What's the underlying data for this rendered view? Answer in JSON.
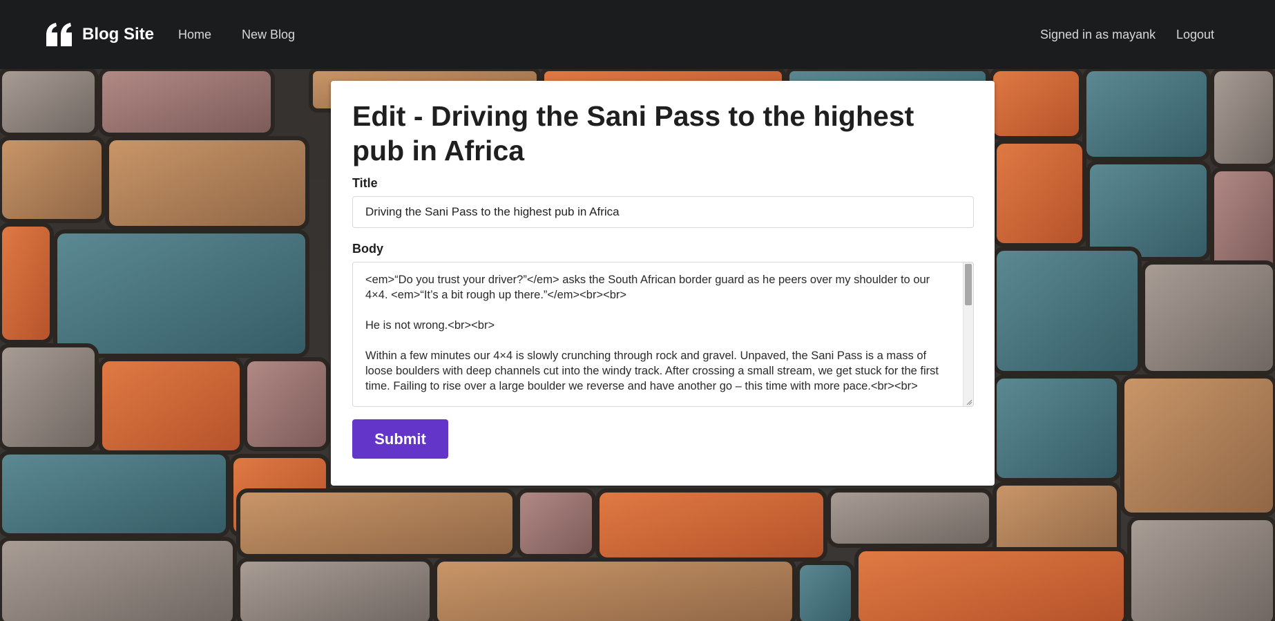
{
  "navbar": {
    "brand": "Blog Site",
    "brand_icon": "quote-icon",
    "links": {
      "home": "Home",
      "new_blog": "New Blog",
      "signed_in": "Signed in as mayank",
      "logout": "Logout"
    }
  },
  "form": {
    "heading": "Edit - Driving the Sani Pass to the highest pub in Africa",
    "title_label": "Title",
    "title_value": "Driving the Sani Pass to the highest pub in Africa",
    "body_label": "Body",
    "body_value": "<em>“Do you trust your driver?”</em> asks the South African border guard as he peers over my shoulder to our 4×4. <em>“It’s a bit rough up there.”</em><br><br>\n\nHe is not wrong.<br><br>\n\nWithin a few minutes our 4×4 is slowly crunching through rock and gravel. Unpaved, the Sani Pass is a mass of loose boulders with deep channels cut into the windy track. After crossing a small stream, we get stuck for the first time. Failing to rise over a large boulder we reverse and have another go – this time with more pace.<br><br>",
    "submit": "Submit"
  },
  "colors": {
    "navbar_bg": "#1b1c1d",
    "submit_bg": "#6435c9",
    "card_bg": "#ffffff"
  }
}
